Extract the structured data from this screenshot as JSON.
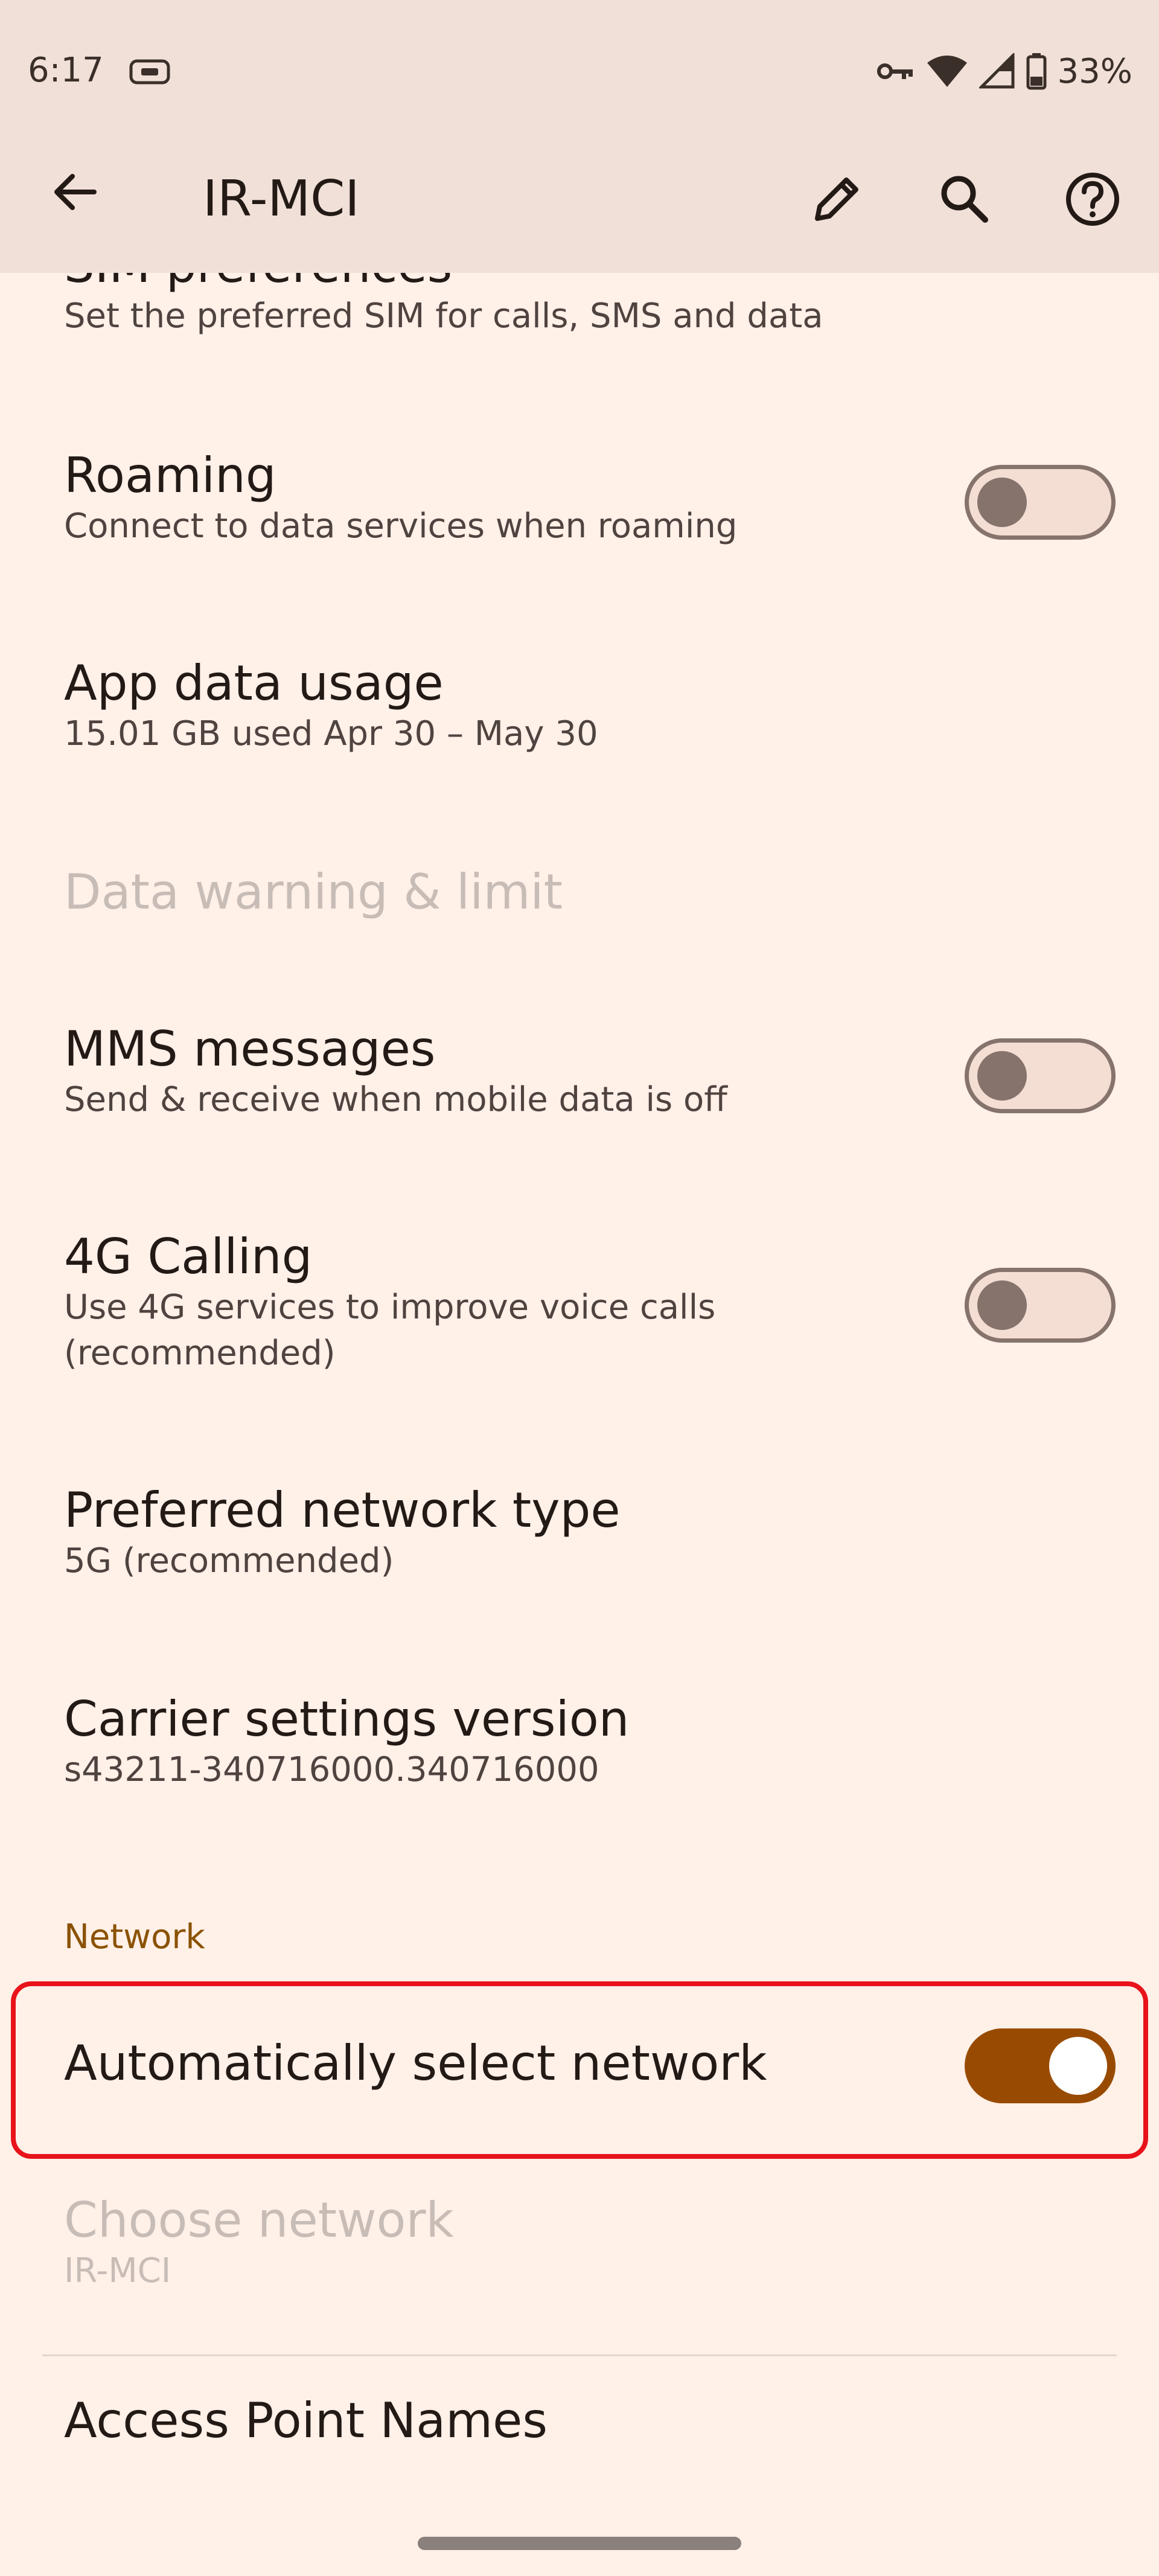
{
  "status_bar": {
    "time": "6:17",
    "battery_percent": "33%",
    "icons": [
      "vpn-icon",
      "key-icon",
      "wifi-icon",
      "signal-icon",
      "battery-icon"
    ]
  },
  "app_bar": {
    "title": "IR-MCI",
    "actions": [
      "back-arrow-icon",
      "edit-pencil-icon",
      "search-icon",
      "help-icon"
    ]
  },
  "preferences": {
    "sim": {
      "title": "SIM preferences",
      "summary": "Set the preferred SIM for calls, SMS and data"
    },
    "roaming": {
      "title": "Roaming",
      "summary": "Connect to data services when roaming",
      "checked": false
    },
    "app_data": {
      "title": "App data usage",
      "summary": "15.01 GB used Apr 30 – May 30"
    },
    "data_warning": {
      "title": "Data warning & limit",
      "disabled": true
    },
    "mms": {
      "title": "MMS messages",
      "summary": "Send & receive when mobile data is off",
      "checked": false
    },
    "calling_4g": {
      "title": "4G Calling",
      "summary": "Use 4G services to improve voice calls (recommended)",
      "checked": false
    },
    "network_type": {
      "title": "Preferred network type",
      "summary": "5G (recommended)"
    },
    "carrier_version": {
      "title": "Carrier settings version",
      "summary": "s43211-340716000.340716000"
    }
  },
  "network_section": {
    "header": "Network",
    "auto_select": {
      "title": "Automatically select network",
      "checked": true
    },
    "choose_network": {
      "title": "Choose network",
      "summary": "IR-MCI",
      "disabled": true
    },
    "apn": {
      "title": "Access Point Names"
    }
  },
  "colors": {
    "background": "#fff0e8",
    "app_bar": "#f0e0d8",
    "accent": "#984b00",
    "section_header": "#8a5200",
    "highlight_border": "#e8131b"
  }
}
